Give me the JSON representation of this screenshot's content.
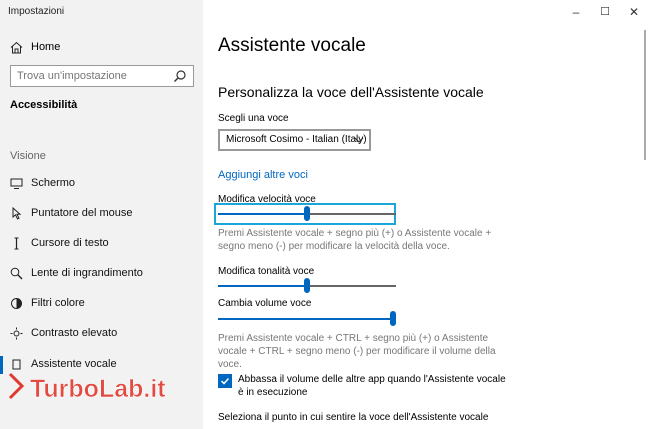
{
  "window": {
    "title": "Impostazioni",
    "controls": {
      "minimize": "–",
      "maximize": "☐",
      "close": "✕"
    }
  },
  "sidebar": {
    "home": "Home",
    "search": {
      "placeholder": "Trova un'impostazione"
    },
    "section": "Accessibilità",
    "group": "Visione",
    "items": [
      {
        "label": "Schermo",
        "icon": "display-icon"
      },
      {
        "label": "Puntatore del mouse",
        "icon": "mouse-pointer-icon"
      },
      {
        "label": "Cursore di testo",
        "icon": "text-cursor-icon"
      },
      {
        "label": "Lente di ingrandimento",
        "icon": "magnifier-icon"
      },
      {
        "label": "Filtri colore",
        "icon": "color-filter-icon"
      },
      {
        "label": "Contrasto elevato",
        "icon": "contrast-icon"
      },
      {
        "label": "Assistente vocale",
        "icon": "narrator-icon",
        "active": true
      }
    ]
  },
  "main": {
    "title": "Assistente vocale",
    "subheading": "Personalizza la voce dell'Assistente vocale",
    "voice": {
      "label": "Scegli una voce",
      "selected": "Microsoft Cosimo - Italian (Italy)"
    },
    "add_voices_link": "Aggiungi altre voci",
    "speed": {
      "label": "Modifica velocità voce",
      "value_fraction": 0.5,
      "hint": "Premi Assistente vocale + segno più (+) o Assistente vocale + segno meno (-) per modificare la velocità della voce."
    },
    "pitch": {
      "label": "Modifica tonalità voce",
      "value_fraction": 0.5
    },
    "volume": {
      "label": "Cambia volume voce",
      "value_fraction": 1.0,
      "hint": "Premi Assistente vocale + CTRL + segno più (+) o Assistente vocale + CTRL + segno meno (-) per modificare il volume della voce."
    },
    "lower_others": {
      "checked": true,
      "label": "Abbassa il volume delle altre app quando l'Assistente vocale è in esecuzione"
    },
    "position_label": "Seleziona il punto in cui sentire la voce dell'Assistente vocale"
  },
  "watermark": {
    "text": "TurboLab.it"
  },
  "colors": {
    "accent": "#0067c0",
    "focus": "#1aa6d8",
    "sidebar_bg": "#f2f2f2"
  }
}
